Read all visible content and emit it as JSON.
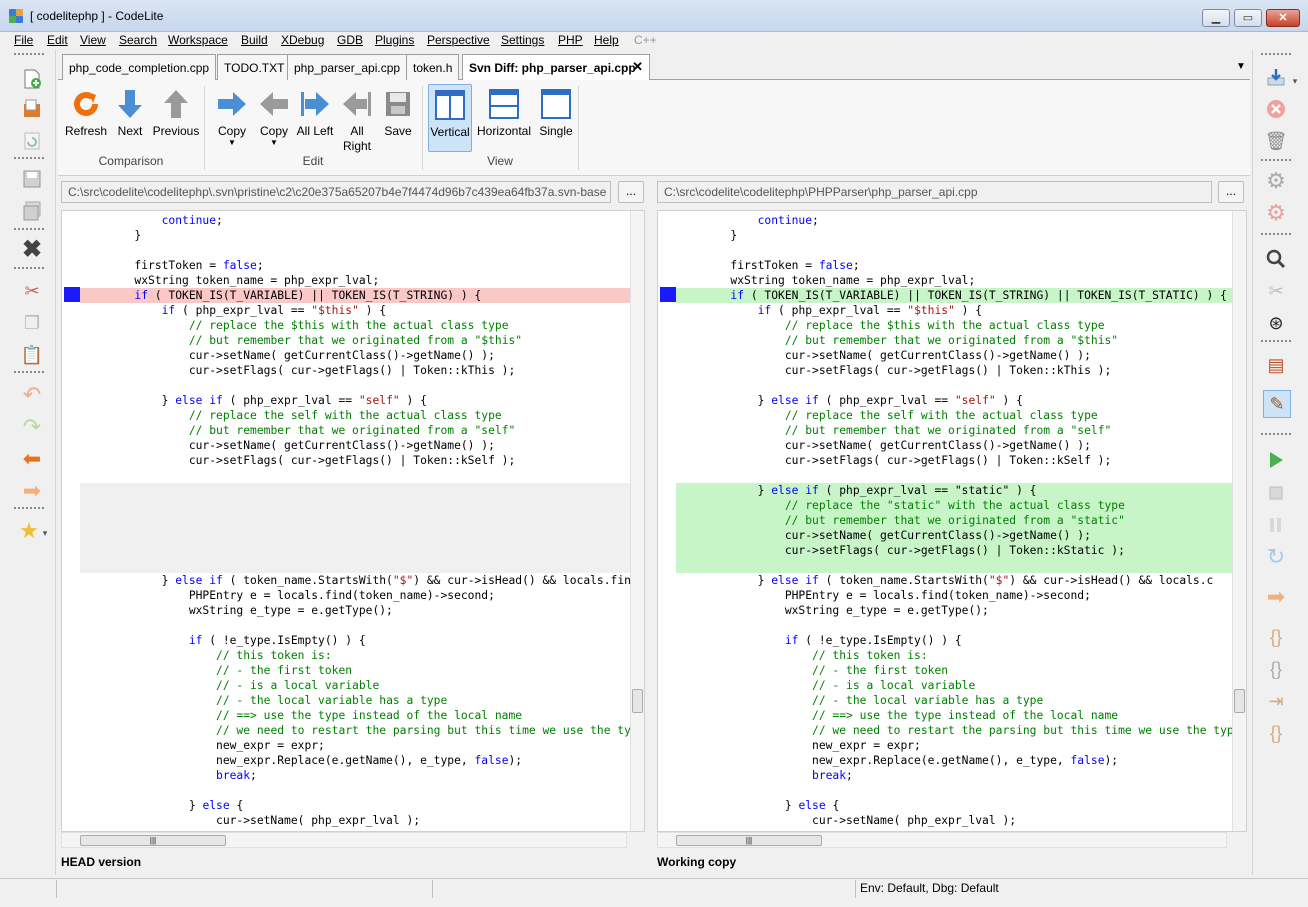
{
  "window": {
    "title": "[ codelitephp ] - CodeLite"
  },
  "menu": [
    "File",
    "Edit",
    "View",
    "Search",
    "Workspace",
    "Build",
    "XDebug",
    "GDB",
    "Plugins",
    "Perspective",
    "Settings",
    "PHP",
    "Help",
    "C++"
  ],
  "tabs": [
    "php_code_completion.cpp",
    "TODO.TXT",
    "php_parser_api.cpp",
    "token.h",
    "Svn Diff: php_parser_api.cpp"
  ],
  "ribbon": {
    "buttons": [
      "Refresh",
      "Next",
      "Previous",
      "Copy",
      "Copy",
      "All Left",
      "All Right",
      "Save",
      "Vertical",
      "Horizontal",
      "Single"
    ],
    "groups": [
      "Comparison",
      "Edit",
      "View"
    ]
  },
  "left_path": "C:\\src\\codelite\\codelitephp\\.svn\\pristine\\c2\\c20e375a65207b4e7f4474d96b7c439ea64fb37a.svn-base",
  "right_path": "C:\\src\\codelite\\codelitephp\\PHPParser\\php_parser_api.cpp",
  "dots_label": "...",
  "left_label": "HEAD version",
  "right_label": "Working copy",
  "status": "Env: Default, Dbg: Default",
  "colors": {
    "deleted": "#fbc8c8",
    "added": "#c8f5c8",
    "marker": "#1a1aff",
    "keyword": "#0000ff",
    "comment": "#008000"
  }
}
